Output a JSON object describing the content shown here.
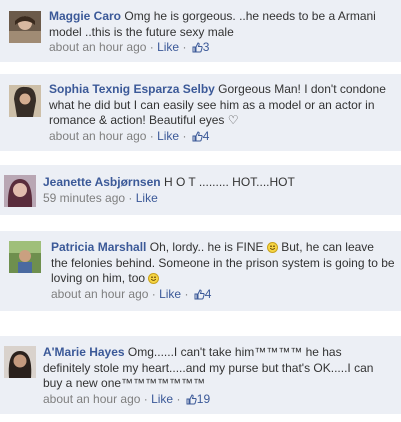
{
  "comments": [
    {
      "author": "Maggie Caro",
      "line1": "Omg he is gorgeous. ..he needs to be a Armani",
      "line2": "model ..this is the future sexy male",
      "time": "about an hour ago",
      "like_label": "Like",
      "like_count": "3",
      "avatar_icon": "avatar-photo"
    },
    {
      "author": "Sophia Texnig Esparza Selby",
      "line1": "Gorgeous Man! I don't condone",
      "line2": "what he did but I can easily see him as a model or an actor in",
      "line3": "romance & action! Beautiful eyes",
      "heart": "♡",
      "time": "about an hour ago",
      "like_label": "Like",
      "like_count": "4",
      "avatar_icon": "avatar-photo"
    },
    {
      "author": "Jeanette Asbjørnsen",
      "line1": "H O T ......... HOT....HOT",
      "time": "59 minutes ago",
      "like_label": "Like",
      "avatar_icon": "avatar-photo"
    },
    {
      "author": "Patricia Marshall",
      "line1a": "Oh, lordy.. he is FINE",
      "line1b": "But, he can leave",
      "line2": "the felonies behind. Someone in the prison system is going to be",
      "line3": "loving on him, too",
      "time": "about an hour ago",
      "like_label": "Like",
      "like_count": "4",
      "avatar_icon": "avatar-photo"
    },
    {
      "author": "A'Marie Hayes",
      "line1": "Omg......I can't take him™™™™ he has",
      "line2": "definitely stole my heart.....and my purse but that's OK.....I can",
      "line3": "buy a new one™™™™™™™",
      "time": "about an hour ago",
      "like_label": "Like",
      "like_count": "19",
      "avatar_icon": "avatar-photo"
    }
  ],
  "sep": " · ",
  "colors": {
    "name": "#3b5998",
    "meta": "#7f7f7f",
    "card_bg": "#eceff5"
  }
}
